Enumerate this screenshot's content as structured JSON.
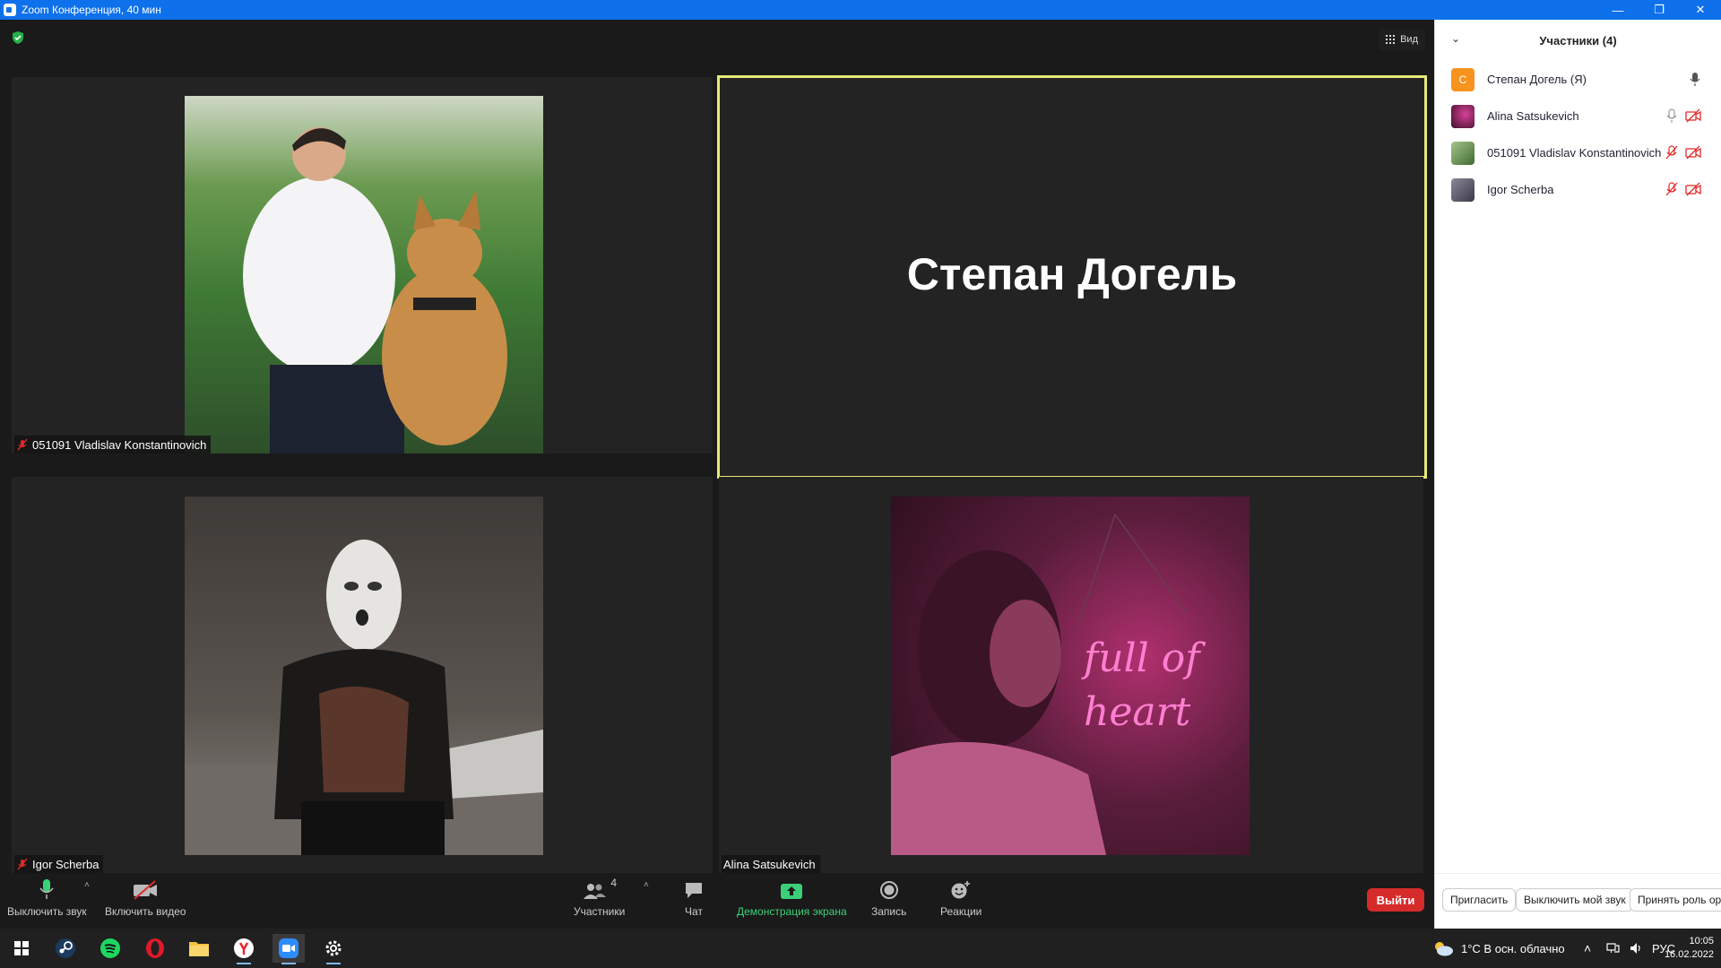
{
  "window": {
    "title": "Zoom Конференция, 40 мин",
    "minimize": "—",
    "restore": "❐",
    "close": "✕"
  },
  "meeting": {
    "view_label": "Вид",
    "tiles": [
      {
        "name": "051091 Vladislav Konstantinovich",
        "muted": true
      },
      {
        "name": "Степан Догель",
        "active_speaker": true
      },
      {
        "name": "Igor Scherba",
        "muted": true
      },
      {
        "name": "Alina Satsukevich",
        "muted": false
      }
    ]
  },
  "controls": {
    "mute_label": "Выключить звук",
    "video_label": "Включить видео",
    "participants_label": "Участники",
    "participants_count": "4",
    "chat_label": "Чат",
    "share_label": "Демонстрация экрана",
    "record_label": "Запись",
    "reactions_label": "Реакции",
    "leave_label": "Выйти",
    "caret": "˄"
  },
  "panel": {
    "title": "Участники (4)",
    "chevron": "⌄",
    "participants": [
      {
        "name": "Степан Догель (Я)",
        "avatar_letter": "С",
        "avatar_color": "#f7931e"
      },
      {
        "name": "Alina Satsukevich",
        "avatar_color": "#5a1040"
      },
      {
        "name": "051091 Vladislav Konstantinovich",
        "avatar_color": "#6b8f4e"
      },
      {
        "name": "Igor Scherba",
        "avatar_color": "#5d5a6e"
      }
    ],
    "invite_label": "Пригласить",
    "mute_me_label": "Выключить мой звук",
    "claim_role_label": "Принять роль орг"
  },
  "taskbar": {
    "weather": "1°C  В осн. облачно",
    "lang": "РУС",
    "time": "10:05",
    "date": "16.02.2022"
  },
  "colors": {
    "zoom_blue": "#0e71eb",
    "active_border": "#e6ea7a",
    "leave_red": "#d62b2b",
    "share_green": "#3ad07a",
    "muted_red": "#e02828"
  }
}
